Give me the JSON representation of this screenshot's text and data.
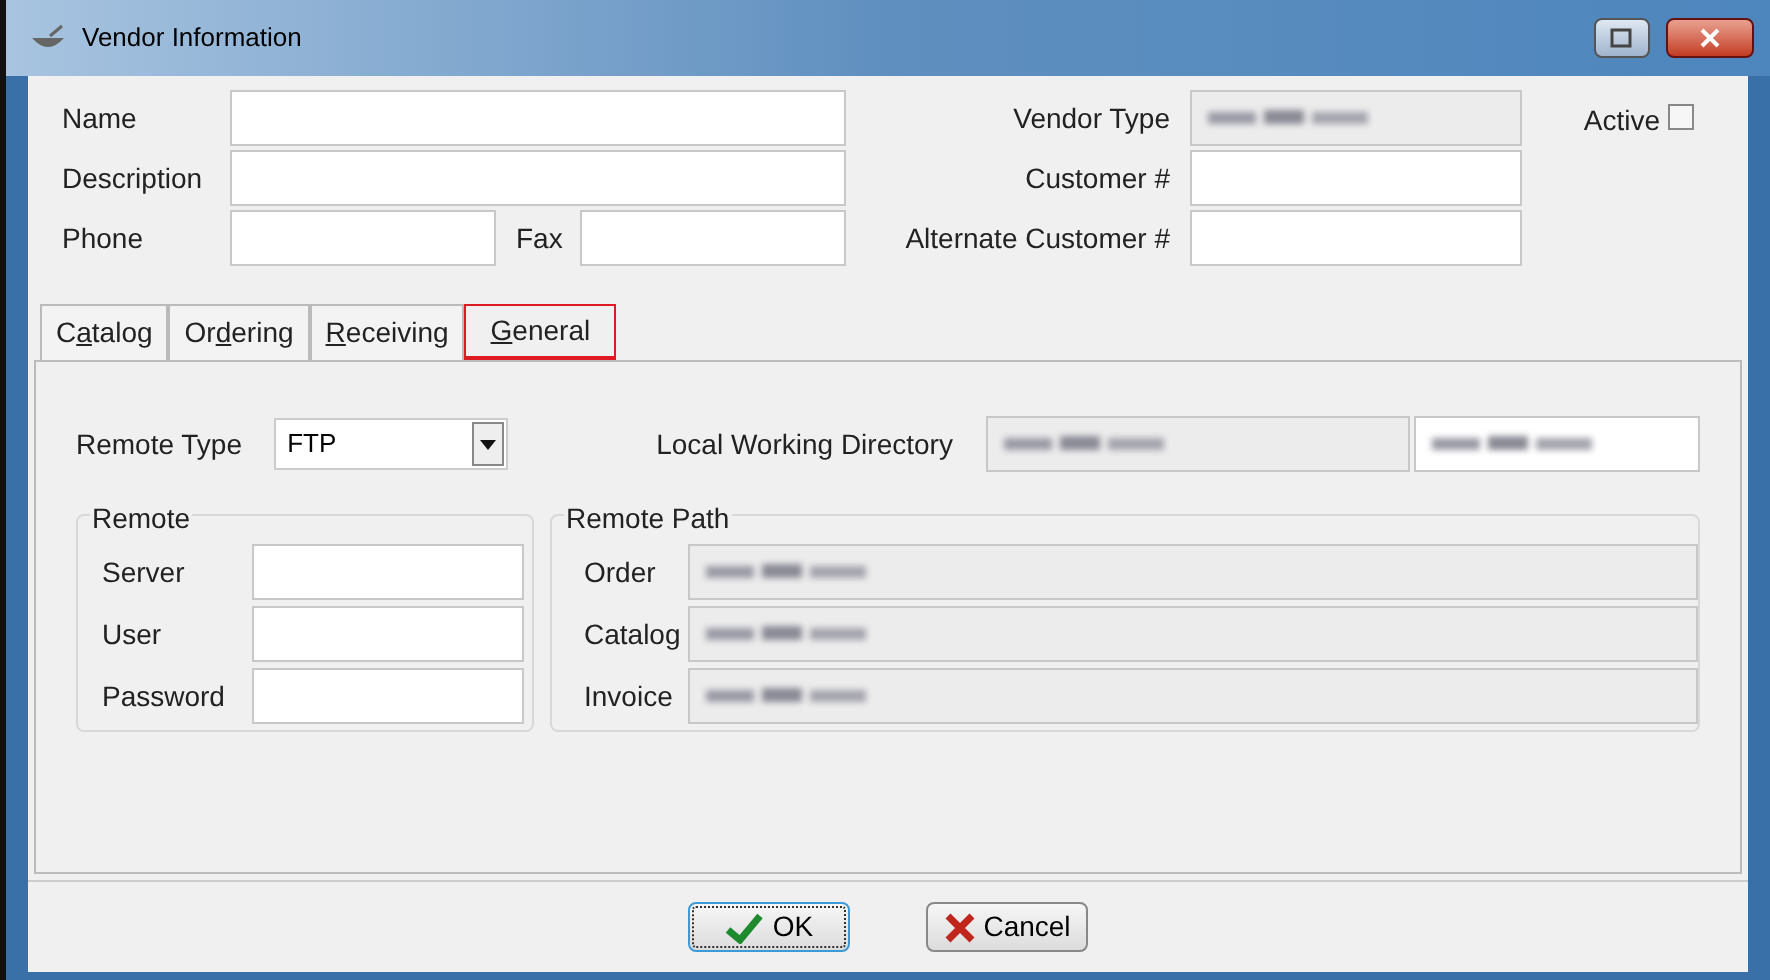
{
  "window": {
    "title": "Vendor Information"
  },
  "header_fields": [
    {
      "label": "Name"
    },
    {
      "label": "Description"
    }
  ],
  "phone": {
    "label": "Phone"
  },
  "fax": {
    "label": "Fax"
  },
  "vendor_type": {
    "label": "Vendor Type",
    "redacted": true,
    "disabled": true
  },
  "customer_number": {
    "label": "Customer #"
  },
  "alternate_customer_number": {
    "label": "Alternate Customer #"
  },
  "active": {
    "label": "Active",
    "checked": false
  },
  "tabs": [
    {
      "before": "C",
      "mnemonic": "a",
      "after": "talog",
      "selected": false
    },
    {
      "before": "Or",
      "mnemonic": "d",
      "after": "ering",
      "selected": false
    },
    {
      "mnemonic": "R",
      "after": "eceiving",
      "selected": false
    },
    {
      "mnemonic": "G",
      "after": "eneral",
      "selected": true
    }
  ],
  "remote_type": {
    "label": "Remote Type",
    "value": "FTP"
  },
  "local_working_directory": {
    "label": "Local Working Directory",
    "redacted": true
  },
  "remote": {
    "title": "Remote",
    "fields": [
      {
        "label": "Server"
      },
      {
        "label": "User"
      },
      {
        "label": "Password"
      }
    ]
  },
  "remote_path": {
    "title": "Remote Path",
    "fields": [
      {
        "label": "Order",
        "redacted": true
      },
      {
        "label": "Catalog",
        "redacted": true
      },
      {
        "label": "Invoice",
        "redacted": true
      }
    ]
  },
  "buttons": [
    {
      "label": "OK",
      "kind": "ok",
      "focused": true
    },
    {
      "label": "Cancel",
      "kind": "cancel",
      "focused": false
    }
  ]
}
